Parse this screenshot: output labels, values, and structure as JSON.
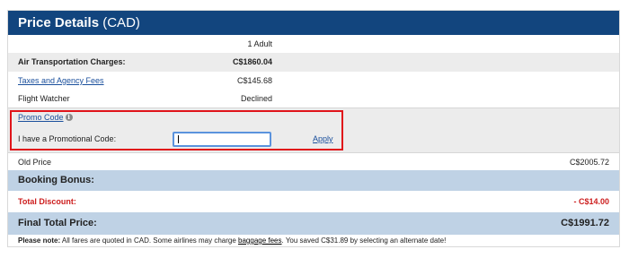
{
  "header": {
    "title": "Price Details",
    "currency": "(CAD)"
  },
  "passengers": "1 Adult",
  "lines": {
    "air": {
      "label": "Air Transportation Charges:",
      "value": "C$1860.04"
    },
    "taxes": {
      "label": "Taxes and Agency Fees",
      "value": "C$145.68"
    },
    "watcher": {
      "label": "Flight Watcher",
      "value": "Declined"
    }
  },
  "promo": {
    "link": "Promo Code",
    "info_icon": "i",
    "prompt": "I have a Promotional Code:",
    "value": "",
    "apply": "Apply"
  },
  "old_price": {
    "label": "Old Price",
    "value": "C$2005.72"
  },
  "bonus": {
    "label": "Booking Bonus:"
  },
  "discount": {
    "label": "Total Discount:",
    "value": "- C$14.00"
  },
  "final": {
    "label": "Final Total Price:",
    "value": "C$1991.72"
  },
  "note": {
    "bold": "Please note:",
    "pre": " All fares are quoted in CAD. Some airlines may charge ",
    "link": "baggage fees",
    "post": ". You saved C$31.89 by selecting an alternate date!"
  },
  "colors": {
    "header_bg": "#12457e",
    "band_bg": "#bfd2e5",
    "discount_red": "#cc1d1d",
    "highlight_border": "#e0141a",
    "input_border": "#5b93dd"
  }
}
